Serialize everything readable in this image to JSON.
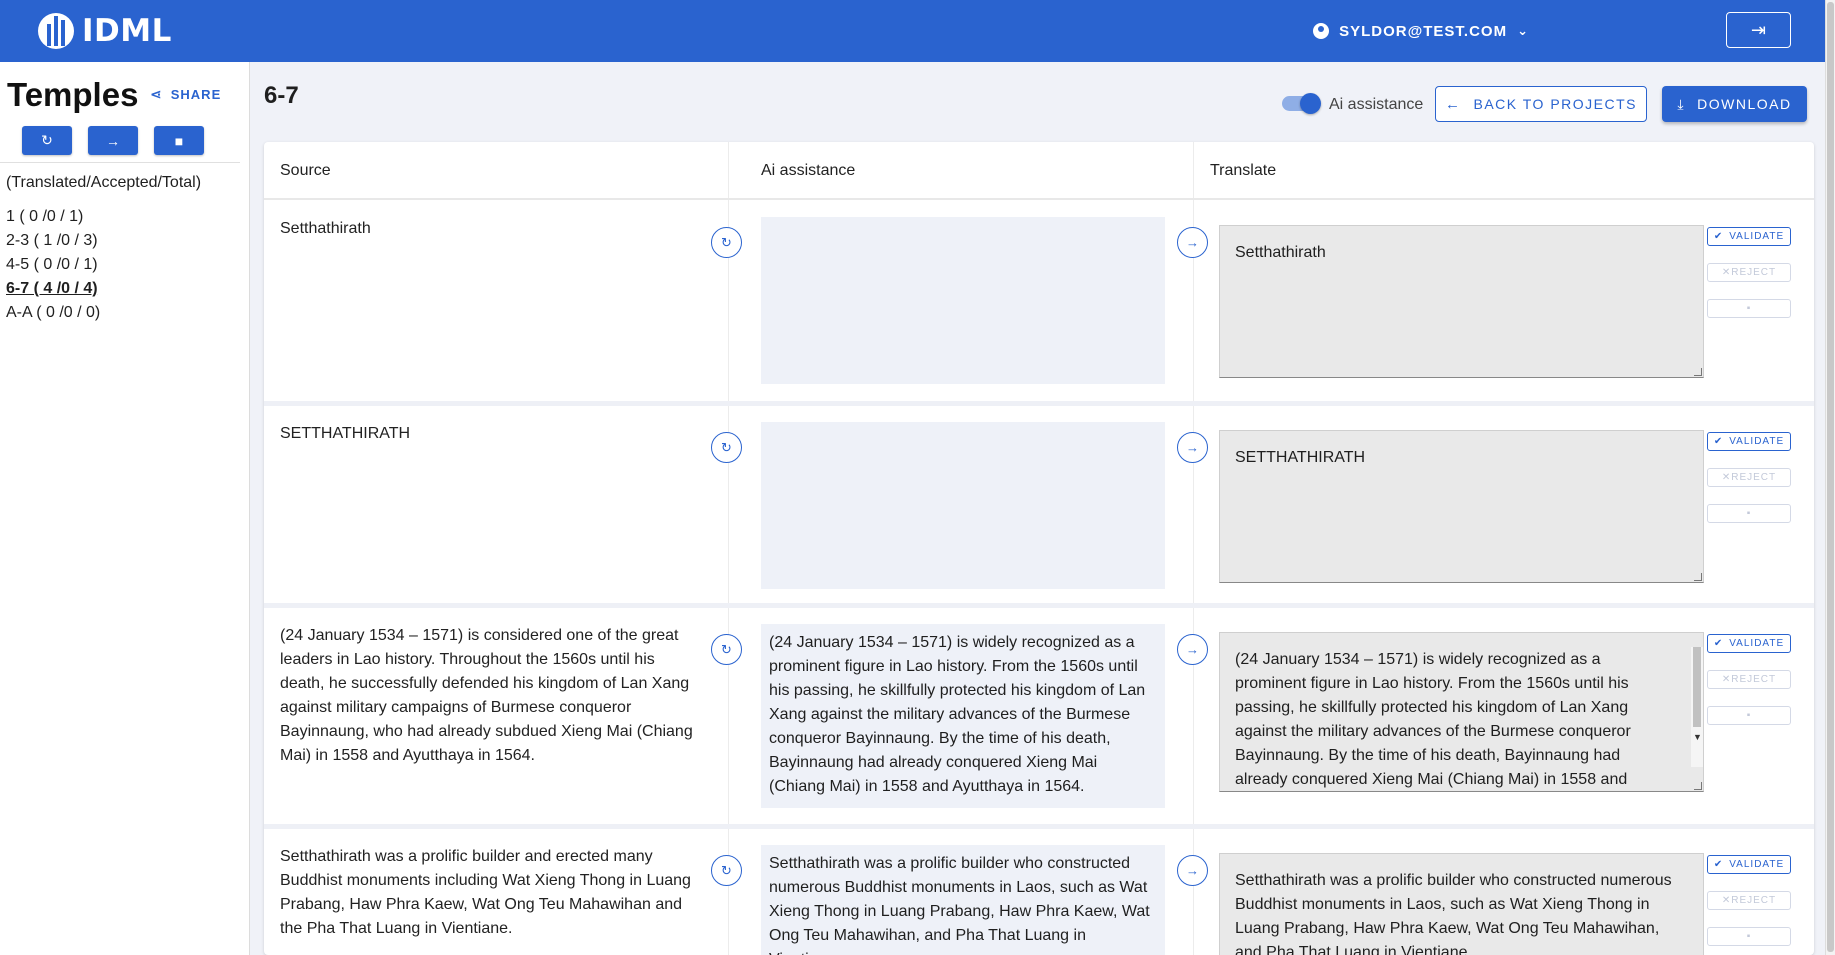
{
  "header": {
    "logo_text": "IDML",
    "user_email": "SYLDOR@TEST.COM"
  },
  "sidebar": {
    "project_title": "Temples",
    "share_label": "SHARE",
    "stats_header": "(Translated/Accepted/Total)",
    "sections": [
      {
        "label": "1 ( 0 /0 / 1)",
        "active": false
      },
      {
        "label": "2-3 ( 1 /0 / 3)",
        "active": false
      },
      {
        "label": "4-5 ( 0 /0 / 1)",
        "active": false
      },
      {
        "label": "6-7 ( 4 /0 / 4)",
        "active": true
      },
      {
        "label": "A-A ( 0 /0 / 0)",
        "active": false
      }
    ]
  },
  "main": {
    "page_title": "6-7",
    "ai_toggle_label": "Ai assistance",
    "ai_toggle_on": true,
    "back_label": "BACK TO PROJECTS",
    "download_label": "DOWNLOAD"
  },
  "table": {
    "columns": [
      "Source",
      "Ai assistance",
      "Translate"
    ],
    "actions": {
      "validate": "VALIDATE",
      "reject": "REJECT"
    },
    "rows": [
      {
        "source": "Setthathirath",
        "ai": "",
        "translate": "Setthathirath"
      },
      {
        "source": "SETTHATHIRATH",
        "ai": "",
        "translate": "SETTHATHIRATH"
      },
      {
        "source": "(24 January 1534 – 1571) is considered one of the great leaders in Lao history. Throughout the 1560s until his death, he successfully defended his kingdom of Lan Xang against military campaigns of Burmese conqueror Bayinnaung, who had already subdued Xieng Mai (Chiang Mai) in 1558 and Ayutthaya in 1564.",
        "ai": "(24 January 1534 – 1571) is widely recognized as a prominent figure in Lao history. From the 1560s until his passing, he skillfully protected his kingdom of Lan Xang against the military advances of the Burmese conqueror Bayinnaung. By the time of his death, Bayinnaung had already conquered Xieng Mai (Chiang Mai) in 1558 and Ayutthaya in 1564.",
        "translate": "(24 January 1534 – 1571) is widely recognized as a prominent figure in Lao history. From the 1560s until his passing, he skillfully protected his kingdom of Lan Xang against the military advances of the Burmese conqueror Bayinnaung. By the time of his death, Bayinnaung had already conquered Xieng Mai (Chiang Mai) in 1558 and"
      },
      {
        "source": "Setthathirath was a prolific builder and erected many Buddhist monuments including Wat Xieng Thong in Luang Prabang, Haw Phra Kaew, Wat Ong Teu Mahawihan and the Pha That Luang in Vientiane.",
        "ai": "Setthathirath was a prolific builder who constructed numerous Buddhist monuments in Laos, such as Wat Xieng Thong in Luang Prabang, Haw Phra Kaew, Wat Ong Teu Mahawihan, and Pha That Luang in Vientiane.",
        "translate": "Setthathirath was a prolific builder who constructed numerous Buddhist monuments in Laos, such as Wat Xieng Thong in Luang Prabang, Haw Phra Kaew, Wat Ong Teu Mahawihan, and Pha That Luang in Vientiane."
      }
    ]
  }
}
